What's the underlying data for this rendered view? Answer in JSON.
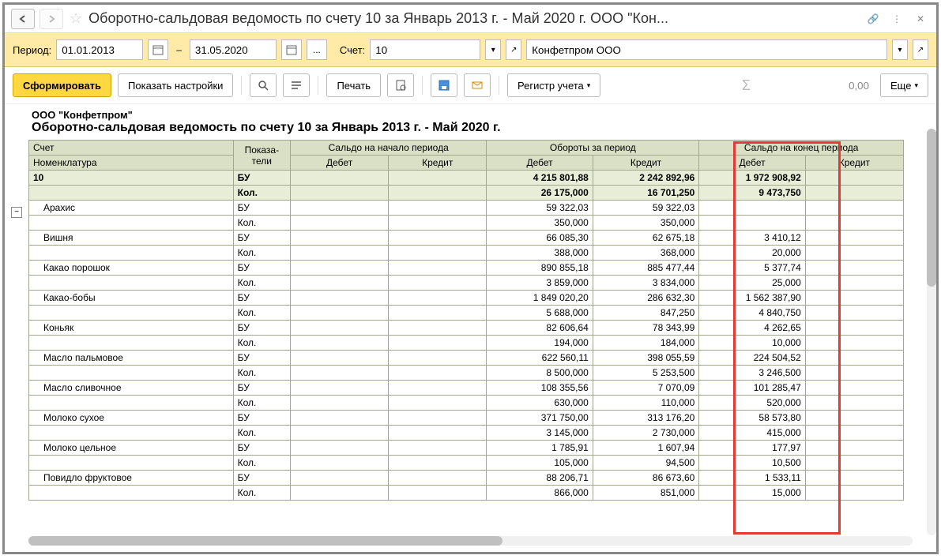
{
  "titlebar": {
    "title": "Оборотно-сальдовая ведомость по счету 10 за Январь 2013 г. - Май 2020 г. ООО \"Кон..."
  },
  "filter": {
    "period_label": "Период:",
    "date_from": "01.01.2013",
    "date_to": "31.05.2020",
    "account_label": "Счет:",
    "account": "10",
    "org": "Конфетпром ООО"
  },
  "toolbar": {
    "form": "Сформировать",
    "settings": "Показать настройки",
    "print": "Печать",
    "register": "Регистр учета",
    "sum": "0,00",
    "more": "Еще"
  },
  "report": {
    "org": "ООО \"Конфетпром\"",
    "title": "Оборотно-сальдовая ведомость по счету 10 за Январь 2013 г. - Май 2020 г.",
    "headers": {
      "account": "Счет",
      "indicator": "Показа-тели",
      "nomenclature": "Номенклатура",
      "open": "Сальдо на начало периода",
      "turn": "Обороты за период",
      "close": "Сальдо на конец периода",
      "debit": "Дебет",
      "credit": "Кредит"
    },
    "totals": {
      "name": "10",
      "bu": {
        "turn_d": "4 215 801,88",
        "turn_c": "2 242 892,96",
        "close_d": "1 972 908,92"
      },
      "qty": {
        "turn_d": "26 175,000",
        "turn_c": "16 701,250",
        "close_d": "9 473,750"
      }
    },
    "rows": [
      {
        "name": "Арахис",
        "bu": {
          "turn_d": "59 322,03",
          "turn_c": "59 322,03",
          "close_d": ""
        },
        "qty": {
          "turn_d": "350,000",
          "turn_c": "350,000",
          "close_d": ""
        }
      },
      {
        "name": "Вишня",
        "bu": {
          "turn_d": "66 085,30",
          "turn_c": "62 675,18",
          "close_d": "3 410,12"
        },
        "qty": {
          "turn_d": "388,000",
          "turn_c": "368,000",
          "close_d": "20,000"
        }
      },
      {
        "name": "Какао порошок",
        "bu": {
          "turn_d": "890 855,18",
          "turn_c": "885 477,44",
          "close_d": "5 377,74"
        },
        "qty": {
          "turn_d": "3 859,000",
          "turn_c": "3 834,000",
          "close_d": "25,000"
        }
      },
      {
        "name": "Какао-бобы",
        "bu": {
          "turn_d": "1 849 020,20",
          "turn_c": "286 632,30",
          "close_d": "1 562 387,90"
        },
        "qty": {
          "turn_d": "5 688,000",
          "turn_c": "847,250",
          "close_d": "4 840,750"
        }
      },
      {
        "name": "Коньяк",
        "bu": {
          "turn_d": "82 606,64",
          "turn_c": "78 343,99",
          "close_d": "4 262,65"
        },
        "qty": {
          "turn_d": "194,000",
          "turn_c": "184,000",
          "close_d": "10,000"
        }
      },
      {
        "name": "Масло пальмовое",
        "bu": {
          "turn_d": "622 560,11",
          "turn_c": "398 055,59",
          "close_d": "224 504,52"
        },
        "qty": {
          "turn_d": "8 500,000",
          "turn_c": "5 253,500",
          "close_d": "3 246,500"
        }
      },
      {
        "name": "Масло сливочное",
        "bu": {
          "turn_d": "108 355,56",
          "turn_c": "7 070,09",
          "close_d": "101 285,47"
        },
        "qty": {
          "turn_d": "630,000",
          "turn_c": "110,000",
          "close_d": "520,000"
        }
      },
      {
        "name": "Молоко сухое",
        "bu": {
          "turn_d": "371 750,00",
          "turn_c": "313 176,20",
          "close_d": "58 573,80"
        },
        "qty": {
          "turn_d": "3 145,000",
          "turn_c": "2 730,000",
          "close_d": "415,000"
        }
      },
      {
        "name": "Молоко цельное",
        "bu": {
          "turn_d": "1 785,91",
          "turn_c": "1 607,94",
          "close_d": "177,97"
        },
        "qty": {
          "turn_d": "105,000",
          "turn_c": "94,500",
          "close_d": "10,500"
        }
      },
      {
        "name": "Повидло фруктовое",
        "bu": {
          "turn_d": "88 206,71",
          "turn_c": "86 673,60",
          "close_d": "1 533,11"
        },
        "qty": {
          "turn_d": "866,000",
          "turn_c": "851,000",
          "close_d": "15,000"
        }
      }
    ],
    "ind_bu": "БУ",
    "ind_qty": "Кол."
  }
}
